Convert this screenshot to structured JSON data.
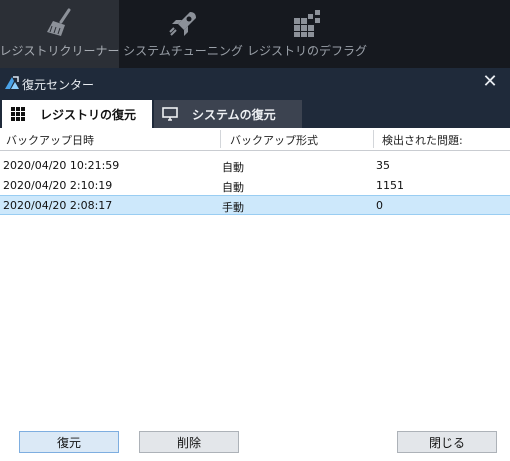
{
  "app_tabs": [
    {
      "label": "レジストリクリーナー",
      "icon": "broom-icon"
    },
    {
      "label": "システムチューニング",
      "icon": "rocket-icon"
    },
    {
      "label": "レジストリのデフラグ",
      "icon": "defrag-grid-icon"
    }
  ],
  "dialog": {
    "title": "復元センター",
    "close_glyph": "✕"
  },
  "tabs": [
    {
      "label": "レジストリの復元",
      "icon": "grid-icon"
    },
    {
      "label": "システムの復元",
      "icon": "monitor-icon"
    }
  ],
  "table": {
    "headers": [
      "バックアップ日時",
      "バックアップ形式",
      "検出された問題:"
    ],
    "rows": [
      [
        "2020/04/20 10:21:59",
        "自動",
        "35"
      ],
      [
        "2020/04/20 2:10:19",
        "自動",
        "1151"
      ],
      [
        "2020/04/20 2:08:17",
        "手動",
        "0"
      ]
    ],
    "selected_row": 2
  },
  "buttons": {
    "restore": "復元",
    "delete": "削除",
    "close": "閉じる"
  },
  "colors": {
    "app_bar": "#16191f",
    "title_bar": "#1f2a3a",
    "selection": "#cde8fb"
  }
}
